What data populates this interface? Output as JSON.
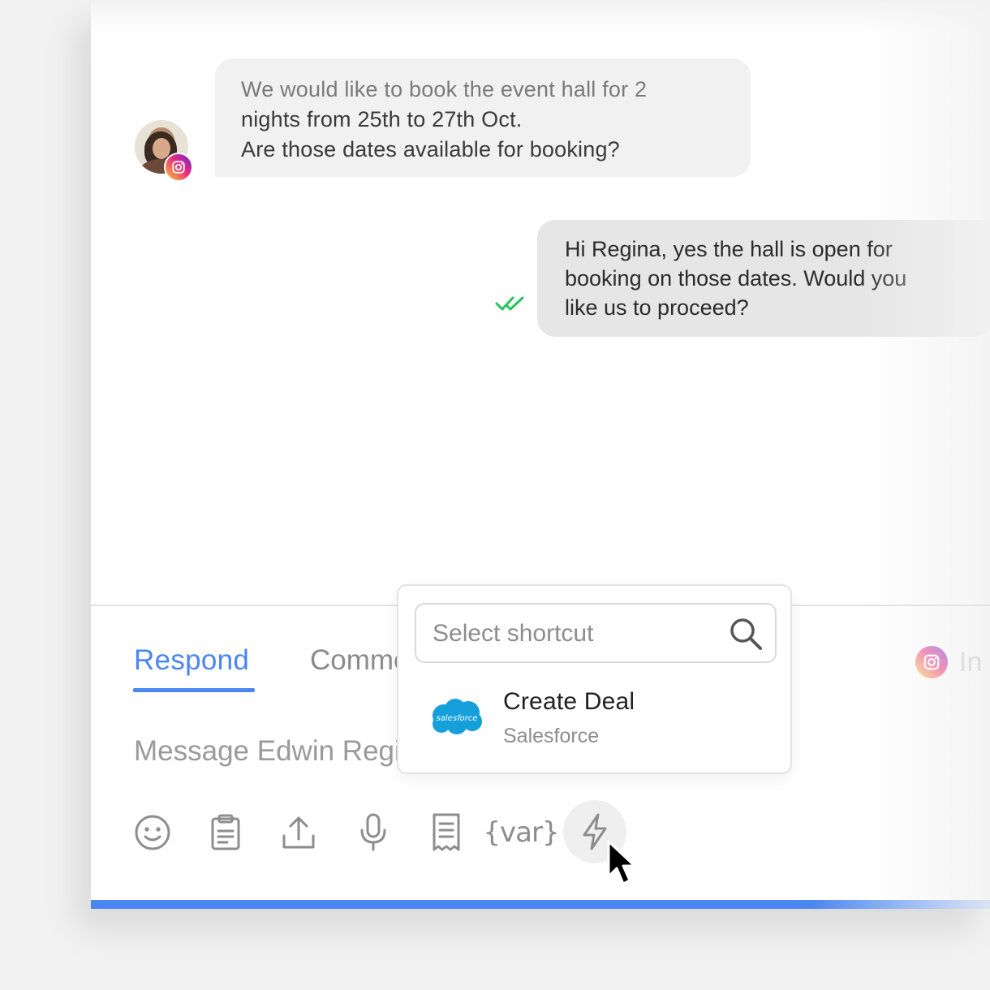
{
  "conversation": {
    "incoming": {
      "lines": [
        "We would like to book the event hall for 2",
        "nights from 25th to 27th Oct.",
        "Are those dates available for booking?"
      ]
    },
    "outgoing": {
      "lines": [
        "Hi Regina, yes the hall is open for",
        "booking on those dates. Would you",
        "like us to proceed?"
      ],
      "status": "read",
      "status_color": "#22c55e"
    }
  },
  "composer": {
    "tabs": [
      {
        "label": "Respond",
        "active": true
      },
      {
        "label": "Comment",
        "active": false
      }
    ],
    "channel_label": "In",
    "placeholder": "Message Edwin Regina",
    "var_label": "{var}",
    "accent_color": "#4a86f0"
  },
  "toolbar": {
    "icons": [
      "emoji-icon",
      "clipboard-icon",
      "upload-icon",
      "microphone-icon",
      "receipt-icon",
      "variable-icon",
      "lightning-icon"
    ]
  },
  "shortcut_popup": {
    "search_placeholder": "Select shortcut",
    "items": [
      {
        "title": "Create Deal",
        "subtitle": "Salesforce",
        "logo_text": "salesforce"
      }
    ]
  }
}
